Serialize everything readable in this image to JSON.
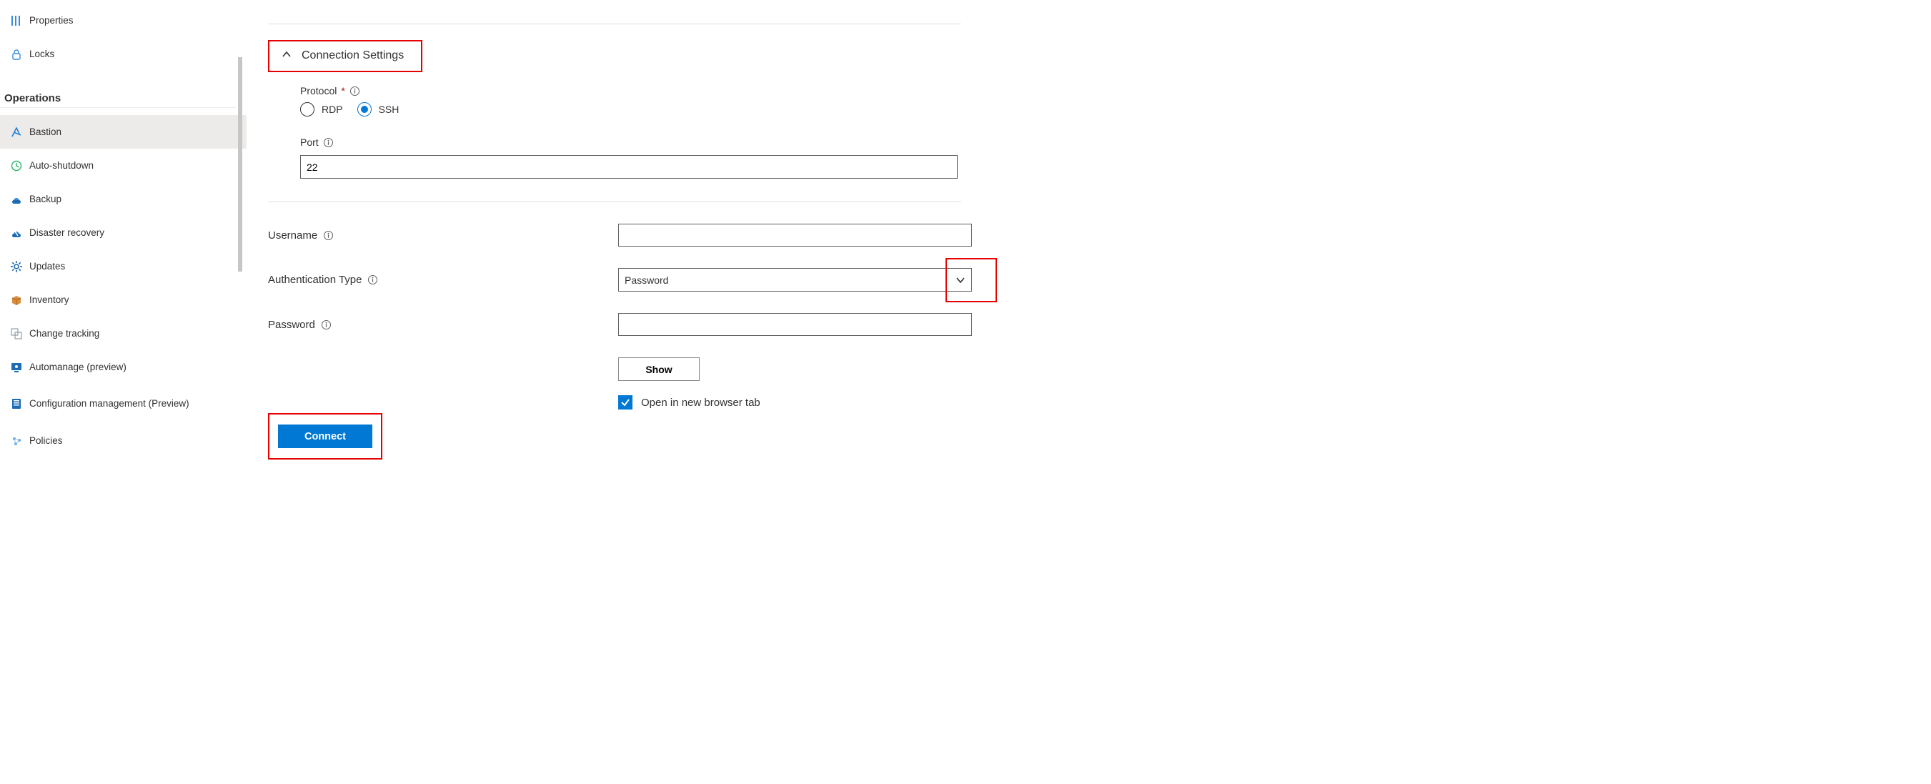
{
  "sidebar": {
    "items_pre": [
      {
        "name": "properties",
        "label": "Properties"
      },
      {
        "name": "locks",
        "label": "Locks"
      }
    ],
    "group_label": "Operations",
    "items_ops": [
      {
        "name": "bastion",
        "label": "Bastion",
        "selected": true
      },
      {
        "name": "autoshutdown",
        "label": "Auto-shutdown"
      },
      {
        "name": "backup",
        "label": "Backup"
      },
      {
        "name": "disaster",
        "label": "Disaster recovery"
      },
      {
        "name": "updates",
        "label": "Updates"
      },
      {
        "name": "inventory",
        "label": "Inventory"
      },
      {
        "name": "changetrack",
        "label": "Change tracking"
      },
      {
        "name": "automanage",
        "label": "Automanage (preview)"
      },
      {
        "name": "configmgmt",
        "label": "Configuration management (Preview)"
      },
      {
        "name": "policies",
        "label": "Policies"
      }
    ]
  },
  "section": {
    "title": "Connection Settings",
    "protocol_label": "Protocol",
    "radio_rdp": "RDP",
    "radio_ssh": "SSH",
    "port_label": "Port",
    "port_value": "22"
  },
  "form": {
    "username_label": "Username",
    "username_value": "",
    "authtype_label": "Authentication Type",
    "authtype_value": "Password",
    "password_label": "Password",
    "password_value": "",
    "show_label": "Show",
    "open_tab_label": "Open in new browser tab",
    "connect_label": "Connect"
  }
}
